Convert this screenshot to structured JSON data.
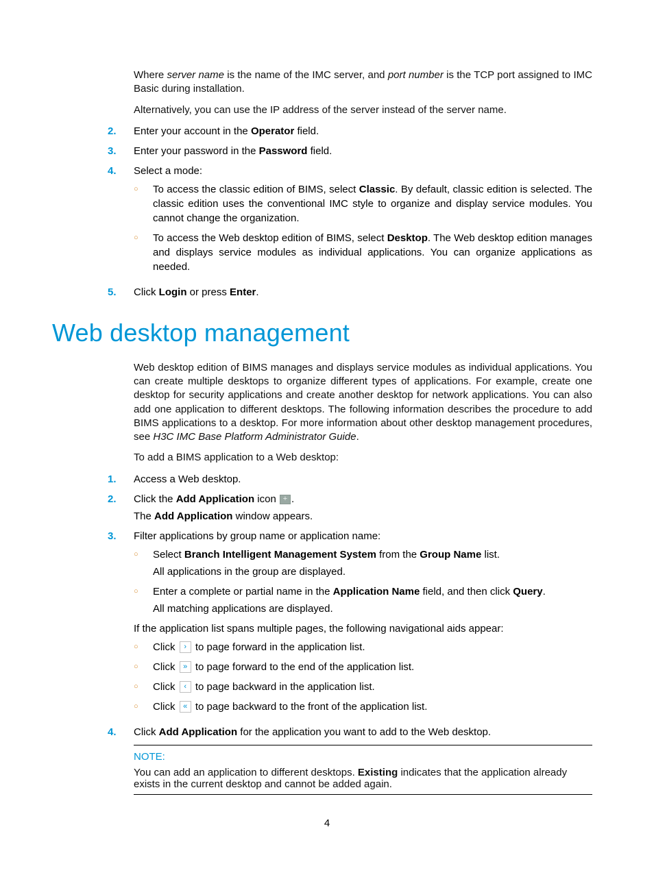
{
  "intro1_pre": "Where ",
  "intro1_i1": "server name",
  "intro1_mid": " is the name of the IMC server, and ",
  "intro1_i2": "port number",
  "intro1_post": " is the TCP port assigned to IMC Basic during installation.",
  "intro2": "Alternatively, you can use the IP address of the server instead of the server name.",
  "markers": {
    "n2": "2.",
    "n3": "3.",
    "n4": "4.",
    "n5": "5.",
    "b1": "1.",
    "b2": "2.",
    "b3": "3.",
    "b4": "4."
  },
  "step2_a": "Enter your account in the ",
  "step2_b": "Operator",
  "step2_c": " field.",
  "step3_a": "Enter your password in the ",
  "step3_b": "Password",
  "step3_c": " field.",
  "step4_lead": "Select a mode:",
  "step4_o1_a": "To access the classic edition of BIMS, select ",
  "step4_o1_b": "Classic",
  "step4_o1_c": ". By default, classic edition is selected. The classic edition uses the conventional IMC style to organize and display service modules. You cannot change the organization.",
  "step4_o2_a": "To access the Web desktop edition of BIMS, select ",
  "step4_o2_b": "Desktop",
  "step4_o2_c": ". The Web desktop edition manages and displays service modules as individual applications. You can organize applications as needed.",
  "step5_a": "Click ",
  "step5_b": "Login",
  "step5_c": " or press ",
  "step5_d": "Enter",
  "step5_e": ".",
  "heading": "Web desktop management",
  "wd_intro_a": "Web desktop edition of BIMS manages and displays service modules as individual applications. You can create multiple desktops to organize different types of applications. For example, create one desktop for security applications and create another desktop for network applications. You can also add one application to different desktops. The following information describes the procedure to add BIMS applications to a desktop. For more information about other desktop management procedures, see ",
  "wd_intro_i": "H3C IMC Base Platform Administrator Guide",
  "wd_intro_b": ".",
  "wd_lead": "To add a BIMS application to a Web desktop:",
  "wd1": "Access a Web desktop.",
  "wd2_a": "Click the ",
  "wd2_b": "Add Application",
  "wd2_c": " icon ",
  "wd2_d": ".",
  "wd2_sub_a": "The ",
  "wd2_sub_b": "Add Application",
  "wd2_sub_c": " window appears.",
  "wd3_lead": "Filter applications by group name or application name:",
  "wd3_o1_a": "Select ",
  "wd3_o1_b": "Branch Intelligent Management System",
  "wd3_o1_c": " from the ",
  "wd3_o1_d": "Group Name",
  "wd3_o1_e": " list.",
  "wd3_o1_sub": "All applications in the group are displayed.",
  "wd3_o2_a": "Enter a complete or partial name in the ",
  "wd3_o2_b": "Application Name",
  "wd3_o2_c": " field, and then click ",
  "wd3_o2_d": "Query",
  "wd3_o2_e": ".",
  "wd3_o2_sub": "All matching applications are displayed.",
  "wd3_pages": "If the application list spans multiple pages, the following navigational aids appear:",
  "nav_click": "Click ",
  "nav1": " to page forward in the application list.",
  "nav2": " to page forward to the end of the application list.",
  "nav3": " to page backward in the application list.",
  "nav4": " to page backward to the front of the application list.",
  "wd4_a": "Click ",
  "wd4_b": "Add Application",
  "wd4_c": " for the application you want to add to the Web desktop.",
  "note_title": "NOTE:",
  "note_a": "You can add an application to different desktops. ",
  "note_b": "Existing",
  "note_c": " indicates that the application already exists in the current desktop and cannot be added again.",
  "page_num": "4",
  "glyphs": {
    "plus": "+",
    "next": "›",
    "last": "»",
    "prev": "‹",
    "first": "«",
    "circ": "○"
  }
}
